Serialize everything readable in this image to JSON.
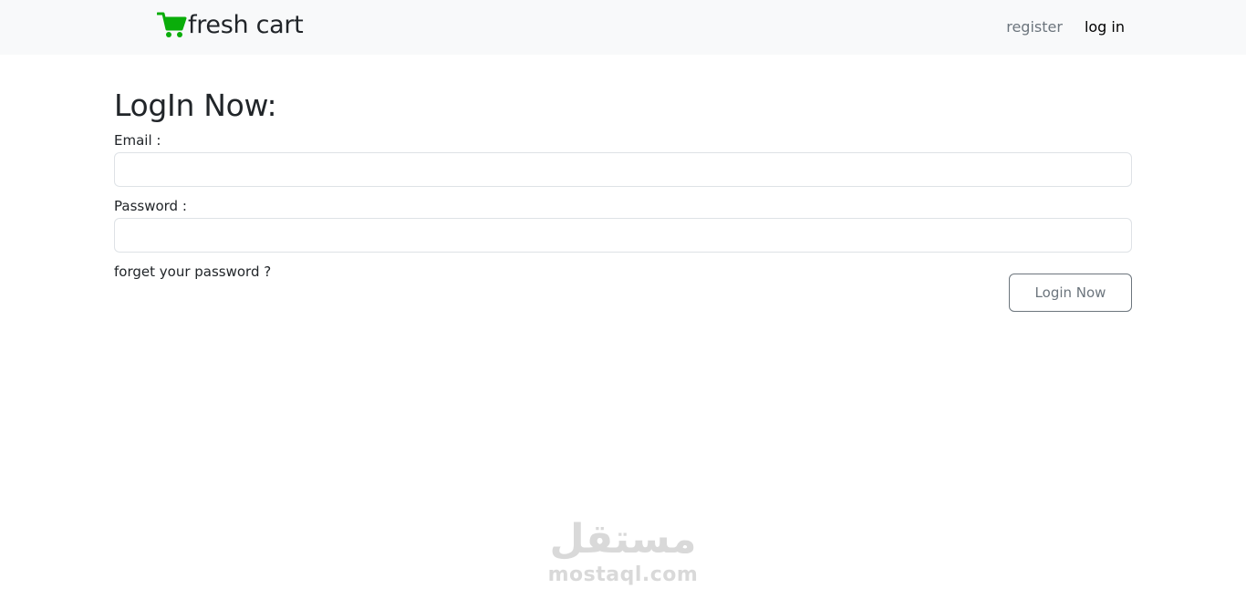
{
  "navbar": {
    "brand": {
      "icon": "shopping-cart-icon",
      "text": "fresh cart",
      "icon_color": "#0aad0a"
    },
    "links": {
      "register": "register",
      "login": "log in"
    }
  },
  "form": {
    "title": "LogIn Now:",
    "email": {
      "label": "Email :",
      "value": "",
      "placeholder": ""
    },
    "password": {
      "label": "Password :",
      "value": "",
      "placeholder": ""
    },
    "forgot_link": "forget your password ?",
    "submit_label": "Login Now"
  },
  "watermark": {
    "arabic": "مستقل",
    "latin": "mostaql.com"
  },
  "colors": {
    "navbar_bg": "#f8f9fa",
    "brand_green": "#0aad0a",
    "muted": "#6c757d",
    "input_border": "#dee2e6"
  }
}
